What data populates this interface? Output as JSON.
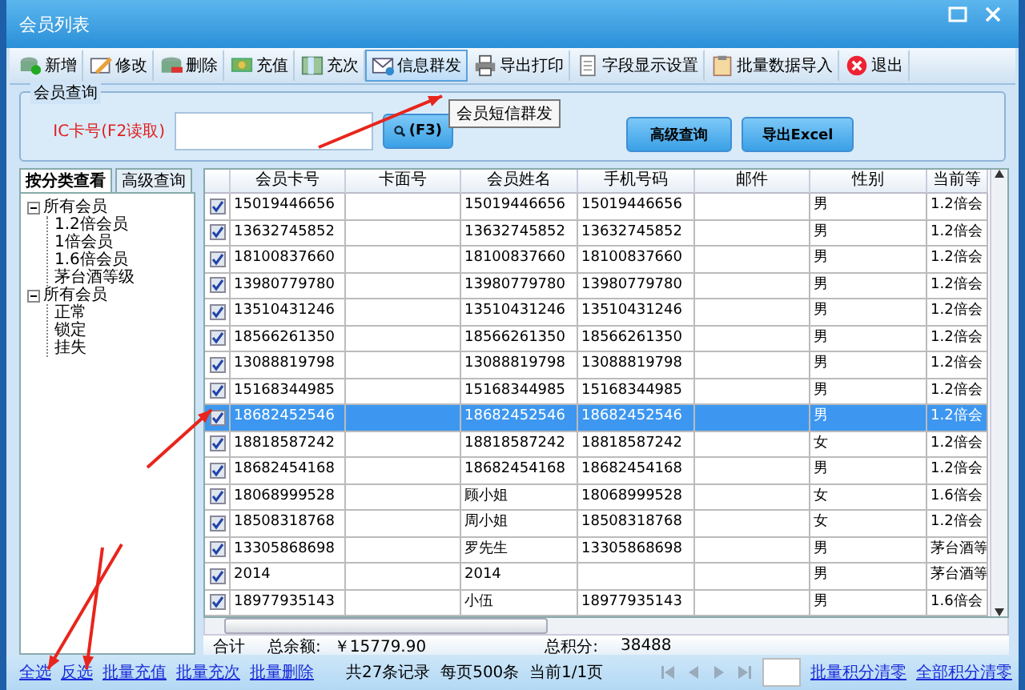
{
  "window": {
    "title": "会员列表"
  },
  "toolbar": [
    {
      "label": "新增",
      "highlighted": false
    },
    {
      "label": "修改",
      "highlighted": false
    },
    {
      "label": "删除",
      "highlighted": false
    },
    {
      "label": "充值",
      "highlighted": false
    },
    {
      "label": "充次",
      "highlighted": false
    },
    {
      "label": "信息群发",
      "highlighted": true
    },
    {
      "label": "导出打印",
      "highlighted": false
    },
    {
      "label": "字段显示设置",
      "highlighted": false
    },
    {
      "label": "批量数据导入",
      "highlighted": false
    },
    {
      "label": "退出",
      "highlighted": false
    }
  ],
  "tooltip": "会员短信群发",
  "query": {
    "title": "会员查询",
    "label": "IC卡号(F2读取)",
    "search_button": "(F3)",
    "advanced_button": "高级查询",
    "export_button": "导出Excel"
  },
  "side_tabs": [
    {
      "label": "按分类查看",
      "selected": true
    },
    {
      "label": "高级查询",
      "selected": false
    }
  ],
  "tree": [
    {
      "label": "所有会员",
      "expanded": true,
      "children": [
        {
          "label": "1.2倍会员"
        },
        {
          "label": "1倍会员"
        },
        {
          "label": "1.6倍会员"
        },
        {
          "label": "茅台酒等级"
        }
      ]
    },
    {
      "label": "所有会员",
      "expanded": true,
      "children": [
        {
          "label": "正常"
        },
        {
          "label": "锁定"
        },
        {
          "label": "挂失"
        }
      ]
    }
  ],
  "table": {
    "columns": [
      "会员卡号",
      "卡面号",
      "会员姓名",
      "手机号码",
      "邮件",
      "性别",
      "当前等"
    ],
    "rows": [
      {
        "checked": true,
        "selected": false,
        "card": "15019446656",
        "name": "15019446656",
        "phone": "15019446656",
        "gender": "男",
        "level": "1.2倍会"
      },
      {
        "checked": true,
        "selected": false,
        "card": "13632745852",
        "name": "13632745852",
        "phone": "13632745852",
        "gender": "男",
        "level": "1.2倍会"
      },
      {
        "checked": true,
        "selected": false,
        "card": "18100837660",
        "name": "18100837660",
        "phone": "18100837660",
        "gender": "男",
        "level": "1.2倍会"
      },
      {
        "checked": true,
        "selected": false,
        "card": "13980779780",
        "name": "13980779780",
        "phone": "13980779780",
        "gender": "男",
        "level": "1.2倍会"
      },
      {
        "checked": true,
        "selected": false,
        "card": "13510431246",
        "name": "13510431246",
        "phone": "13510431246",
        "gender": "男",
        "level": "1.2倍会"
      },
      {
        "checked": true,
        "selected": false,
        "card": "18566261350",
        "name": "18566261350",
        "phone": "18566261350",
        "gender": "男",
        "level": "1.2倍会"
      },
      {
        "checked": true,
        "selected": false,
        "card": "13088819798",
        "name": "13088819798",
        "phone": "13088819798",
        "gender": "男",
        "level": "1.2倍会"
      },
      {
        "checked": true,
        "selected": false,
        "card": "15168344985",
        "name": "15168344985",
        "phone": "15168344985",
        "gender": "男",
        "level": "1.2倍会"
      },
      {
        "checked": true,
        "selected": true,
        "card": "18682452546",
        "name": "18682452546",
        "phone": "18682452546",
        "gender": "男",
        "level": "1.2倍会"
      },
      {
        "checked": true,
        "selected": false,
        "card": "18818587242",
        "name": "18818587242",
        "phone": "18818587242",
        "gender": "女",
        "level": "1.2倍会"
      },
      {
        "checked": true,
        "selected": false,
        "card": "18682454168",
        "name": "18682454168",
        "phone": "18682454168",
        "gender": "男",
        "level": "1.2倍会"
      },
      {
        "checked": true,
        "selected": false,
        "card": "18068999528",
        "name": "顾小姐",
        "phone": "18068999528",
        "gender": "女",
        "level": "1.6倍会"
      },
      {
        "checked": true,
        "selected": false,
        "card": "18508318768",
        "name": "周小姐",
        "phone": "18508318768",
        "gender": "女",
        "level": "1.2倍会"
      },
      {
        "checked": true,
        "selected": false,
        "card": "13305868698",
        "name": "罗先生",
        "phone": "13305868698",
        "gender": "男",
        "level": "茅台酒等"
      },
      {
        "checked": true,
        "selected": false,
        "card": "2014",
        "name": "2014",
        "gender": "男",
        "level": "茅台酒等"
      },
      {
        "checked": true,
        "selected": false,
        "card": "18977935143",
        "name": "小伍",
        "phone": "18977935143",
        "gender": "男",
        "level": "1.6倍会"
      }
    ]
  },
  "totals": {
    "label": "合计",
    "balance_label": "总余额:",
    "balance": "￥15779.90",
    "points_label": "总积分:",
    "points": "38488"
  },
  "bottom_links": [
    "全选",
    "反选",
    "批量充值",
    "批量充次",
    "批量删除"
  ],
  "paging": {
    "summary": "共27条记录  每页500条  当前1/1页"
  },
  "right_links": [
    "批量积分清零",
    "全部积分清零"
  ]
}
